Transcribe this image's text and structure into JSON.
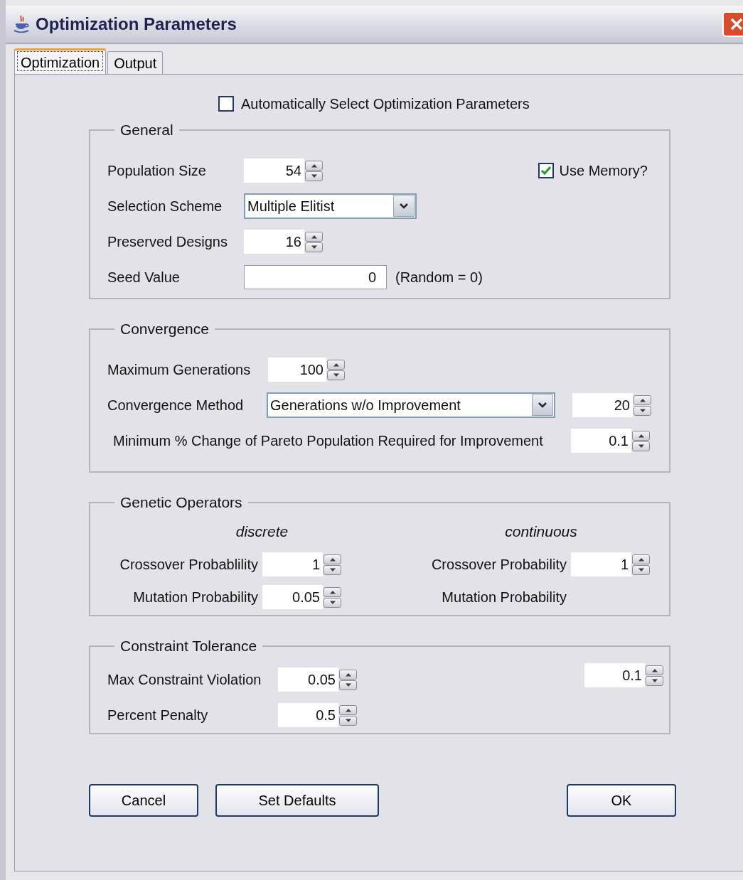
{
  "window": {
    "title": "Optimization Parameters"
  },
  "tabs": [
    {
      "label": "Optimization",
      "selected": true
    },
    {
      "label": "Output",
      "selected": false
    }
  ],
  "auto_select": {
    "label": "Automatically Select Optimization Parameters",
    "checked": false
  },
  "general": {
    "title": "General",
    "population_size": {
      "label": "Population Size",
      "value": "54"
    },
    "use_memory": {
      "label": "Use Memory?",
      "checked": true
    },
    "selection_scheme": {
      "label": "Selection Scheme",
      "value": "Multiple Elitist"
    },
    "preserved_designs": {
      "label": "Preserved Designs",
      "value": "16"
    },
    "seed_value": {
      "label": "Seed Value",
      "value": "0",
      "note": "(Random = 0)"
    }
  },
  "convergence": {
    "title": "Convergence",
    "maximum_generations": {
      "label": "Maximum Generations",
      "value": "100"
    },
    "convergence_method": {
      "label": "Convergence Method",
      "value": "Generations w/o Improvement",
      "count": "20"
    },
    "minimum_change": {
      "label": "Minimum % Change of Pareto Population Required for Improvement",
      "value": "0.1"
    }
  },
  "genetic_operators": {
    "title": "Genetic Operators",
    "discrete": {
      "heading": "discrete",
      "crossover": {
        "label": "Crossover Probablility",
        "value": "1"
      },
      "mutation": {
        "label": "Mutation Probability",
        "value": "0.05"
      }
    },
    "continuous": {
      "heading": "continuous",
      "crossover": {
        "label": "Crossover Probability",
        "value": "1"
      },
      "mutation": {
        "label": "Mutation Probability"
      }
    }
  },
  "constraint_tolerance": {
    "title": "Constraint Tolerance",
    "max_violation": {
      "label": "Max Constraint Violation",
      "value": "0.05"
    },
    "percent_penalty": {
      "label": "Percent Penalty",
      "value": "0.5"
    },
    "unlabeled_spinner": {
      "value": "0.1"
    }
  },
  "buttons": [
    "Cancel",
    "Set Defaults",
    "OK"
  ]
}
